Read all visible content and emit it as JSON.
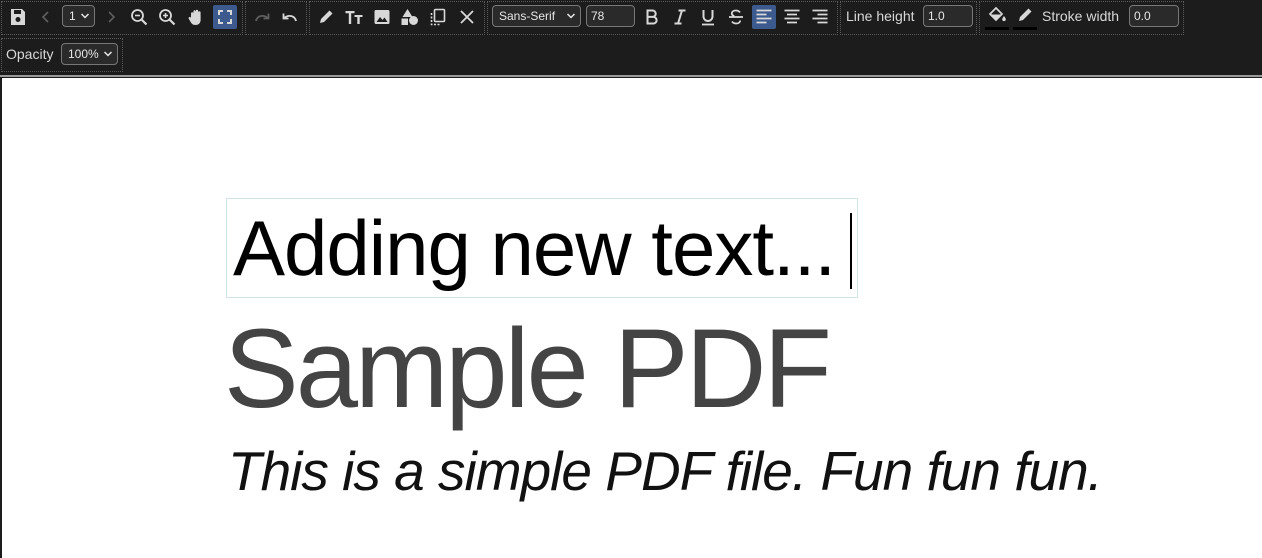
{
  "toolbar": {
    "page_select": "1",
    "font_family": "Sans-Serif",
    "font_size": "78",
    "line_height_label": "Line height",
    "line_height_value": "1.0",
    "stroke_width_label": "Stroke width",
    "stroke_width_value": "0.0",
    "opacity_label": "Opacity",
    "opacity_value": "100%"
  },
  "document": {
    "editing_text": "Adding new text...",
    "title": "Sample PDF",
    "body": "This is a simple PDF file. Fun fun fun."
  },
  "colors": {
    "active_tool": "#3d5a8e",
    "toolbar_bg": "#1c1c1c",
    "fill_color": "#000000",
    "stroke_color": "#000000"
  }
}
